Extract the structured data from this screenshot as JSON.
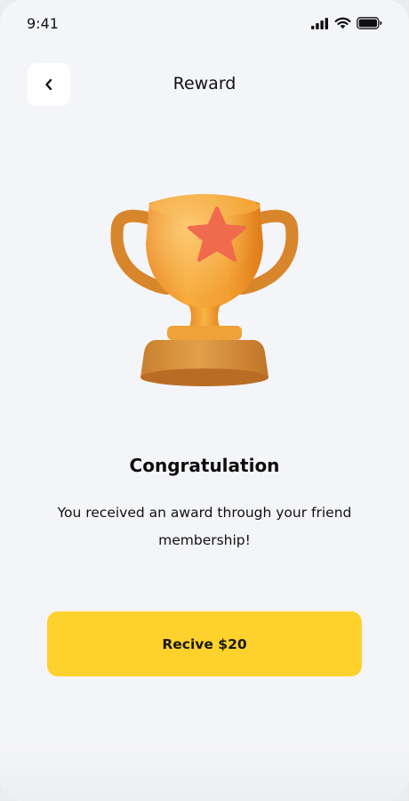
{
  "status_bar": {
    "time": "9:41"
  },
  "header": {
    "title": "Reward"
  },
  "reward": {
    "headline": "Congratulation",
    "message": "You received an award through your friend membership!"
  },
  "cta": {
    "label": "Recive $20"
  },
  "colors": {
    "background": "#f4f5f9",
    "accent": "#ffd12c",
    "trophy": "#f0a236",
    "star": "#f06a4e"
  },
  "icons": {
    "back": "chevron-left-icon",
    "signal": "cellular-signal-icon",
    "wifi": "wifi-icon",
    "battery": "battery-icon",
    "trophy": "trophy-icon"
  }
}
